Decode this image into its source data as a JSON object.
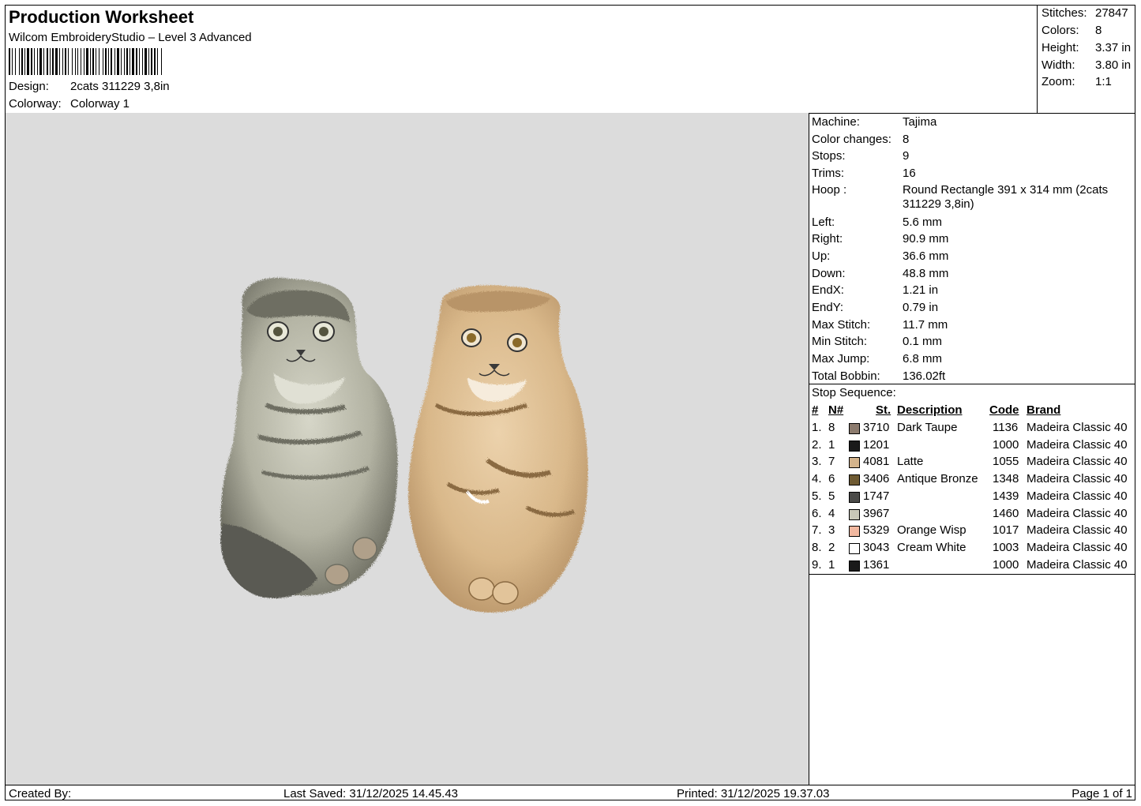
{
  "header": {
    "title": "Production Worksheet",
    "software": "Wilcom EmbroideryStudio – Level 3 Advanced",
    "design_label": "Design:",
    "design_value": "2cats 311229 3,8in",
    "colorway_label": "Colorway:",
    "colorway_value": "Colorway 1"
  },
  "stats": [
    {
      "label": "Stitches:",
      "value": "27847"
    },
    {
      "label": "Colors:",
      "value": "8"
    },
    {
      "label": "Height:",
      "value": "3.37 in"
    },
    {
      "label": "Width:",
      "value": "3.80 in"
    },
    {
      "label": "Zoom:",
      "value": "1:1"
    }
  ],
  "machine_info": [
    {
      "label": "Machine:",
      "value": "Tajima"
    },
    {
      "label": "Color changes:",
      "value": "8"
    },
    {
      "label": "Stops:",
      "value": "9"
    },
    {
      "label": "Trims:",
      "value": "16"
    },
    {
      "label": "Hoop :",
      "value": "Round Rectangle 391 x 314 mm (2cats 311229 3,8in)"
    },
    {
      "label": "Left:",
      "value": "5.6 mm"
    },
    {
      "label": "Right:",
      "value": "90.9 mm"
    },
    {
      "label": "Up:",
      "value": "36.6 mm"
    },
    {
      "label": "Down:",
      "value": "48.8 mm"
    },
    {
      "label": "EndX:",
      "value": "1.21 in"
    },
    {
      "label": "EndY:",
      "value": "0.79 in"
    },
    {
      "label": "Max Stitch:",
      "value": "11.7 mm"
    },
    {
      "label": "Min Stitch:",
      "value": "0.1 mm"
    },
    {
      "label": "Max Jump:",
      "value": "6.8 mm"
    },
    {
      "label": "Total Bobbin:",
      "value": "136.02ft"
    }
  ],
  "stop_sequence": {
    "title": "Stop Sequence:",
    "headers": {
      "num": "#",
      "n": "N#",
      "st": "St.",
      "description": "Description",
      "code": "Code",
      "brand": "Brand"
    },
    "rows": [
      {
        "num": "1.",
        "n": "8",
        "color": "#8c7b6e",
        "st": "3710",
        "description": "Dark Taupe",
        "code": "1136",
        "brand": "Madeira Classic 40"
      },
      {
        "num": "2.",
        "n": "1",
        "color": "#1a1a1a",
        "st": "1201",
        "description": "",
        "code": "1000",
        "brand": "Madeira Classic 40"
      },
      {
        "num": "3.",
        "n": "7",
        "color": "#d4b48c",
        "st": "4081",
        "description": "Latte",
        "code": "1055",
        "brand": "Madeira Classic 40"
      },
      {
        "num": "4.",
        "n": "6",
        "color": "#6e5a32",
        "st": "3406",
        "description": "Antique Bronze",
        "code": "1348",
        "brand": "Madeira Classic 40"
      },
      {
        "num": "5.",
        "n": "5",
        "color": "#4a4a48",
        "st": "1747",
        "description": "",
        "code": "1439",
        "brand": "Madeira Classic 40"
      },
      {
        "num": "6.",
        "n": "4",
        "color": "#c9c8b8",
        "st": "3967",
        "description": "",
        "code": "1460",
        "brand": "Madeira Classic 40"
      },
      {
        "num": "7.",
        "n": "3",
        "color": "#f2b8a0",
        "st": "5329",
        "description": "Orange Wisp",
        "code": "1017",
        "brand": "Madeira Classic 40"
      },
      {
        "num": "8.",
        "n": "2",
        "color": "#ffffff",
        "st": "3043",
        "description": "Cream White",
        "code": "1003",
        "brand": "Madeira Classic 40"
      },
      {
        "num": "9.",
        "n": "1",
        "color": "#1a1a1a",
        "st": "1361",
        "description": "",
        "code": "1000",
        "brand": "Madeira Classic 40"
      }
    ]
  },
  "footer": {
    "created_by": "Created By:",
    "last_saved": "Last Saved: 31/12/2025 14.45.43",
    "printed": "Printed: 31/12/2025 19.37.03",
    "page": "Page 1 of 1"
  },
  "colors": {
    "preview_background": "#dcdcdc",
    "gray_cat_light": "#c8c8b8",
    "gray_cat_dark": "#5a5a52",
    "tan_cat_light": "#e2c49a",
    "tan_cat_dark": "#a8865a"
  }
}
